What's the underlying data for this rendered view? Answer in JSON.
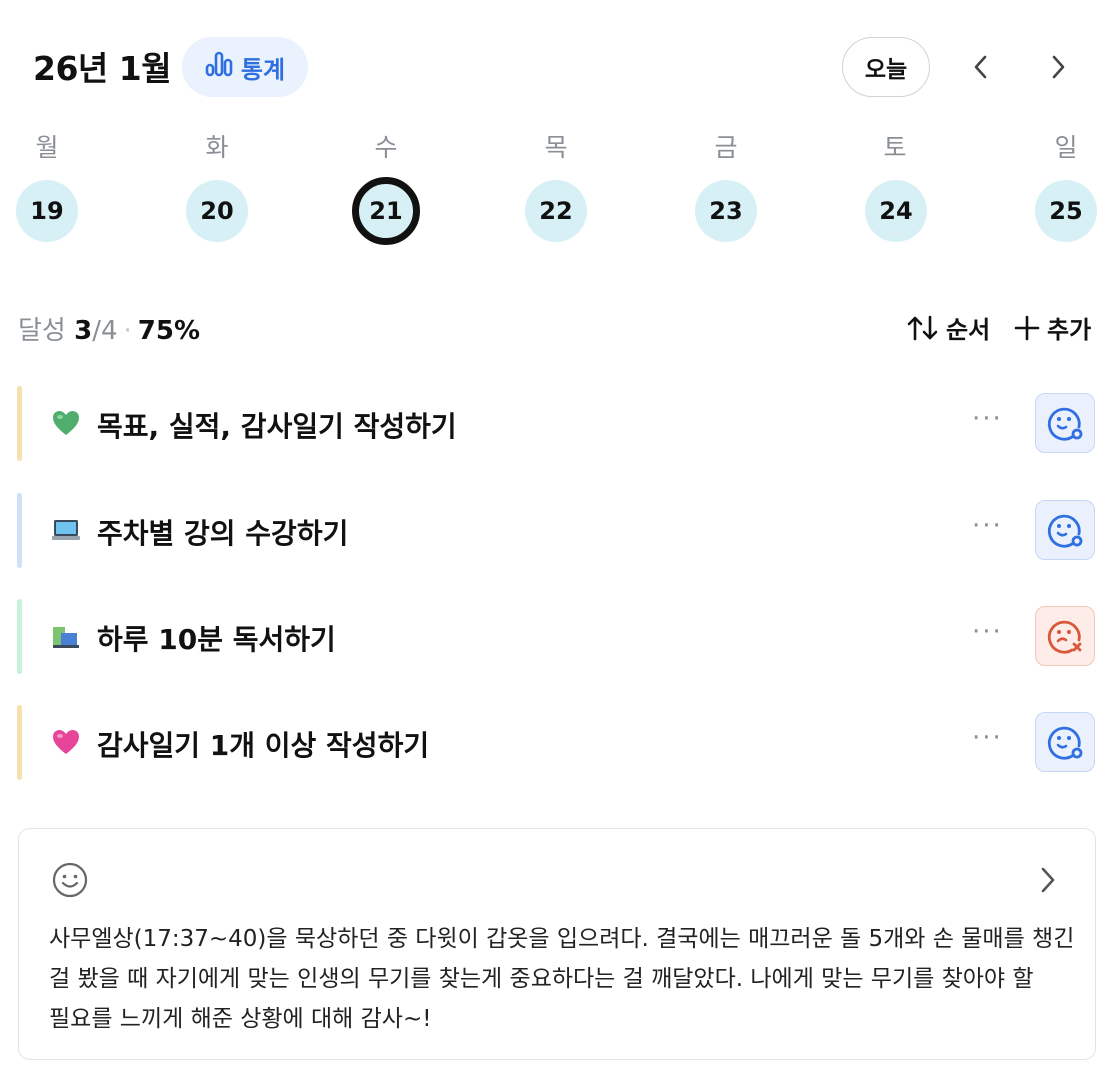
{
  "header": {
    "title": "26년 1월",
    "stats_label": "통계",
    "today_label": "오늘"
  },
  "week": {
    "days": [
      {
        "dow": "월",
        "date": "19"
      },
      {
        "dow": "화",
        "date": "20"
      },
      {
        "dow": "수",
        "date": "21"
      },
      {
        "dow": "목",
        "date": "22"
      },
      {
        "dow": "금",
        "date": "23"
      },
      {
        "dow": "토",
        "date": "24"
      },
      {
        "dow": "일",
        "date": "25"
      }
    ],
    "selected_date": "21"
  },
  "summary": {
    "label": "달성",
    "done": "3",
    "total": "/4",
    "separator": "·",
    "percent": "75%"
  },
  "toolbar": {
    "sort_label": "순서",
    "add_label": "추가"
  },
  "habits": [
    {
      "label": "목표, 실적, 감사일기 작성하기",
      "icon": "green-heart-icon",
      "status": "success"
    },
    {
      "label": "주차별 강의 수강하기",
      "icon": "laptop-icon",
      "status": "success"
    },
    {
      "label": "하루 10분 독서하기",
      "icon": "books-icon",
      "status": "fail"
    },
    {
      "label": "감사일기 1개 이상 작성하기",
      "icon": "pink-heart-icon",
      "status": "success"
    }
  ],
  "more_label": "···",
  "note": {
    "text": "사무엘상(17:37~40)을 묵상하던 중 다윗이 갑옷을 입으려다. 결국에는 매끄러운 돌 5개와 손 물매를 챙긴 걸 봤을 때 자기에게 맞는 인생의 무기를 찾는게 중요하다는 걸 깨달았다. 나에게 맞는 무기를 찾아야 할 필요를 느끼게 해준 상황에 대해 감사~!"
  },
  "colors": {
    "accent": "#2f6fe0",
    "day_bg": "#d6f0f6",
    "bar_1": "#f7dfb0",
    "bar_2": "#d3dff6",
    "bar_3": "#c9f0dc",
    "bar_4": "#f7dfb0",
    "fail": "#d9573a"
  }
}
